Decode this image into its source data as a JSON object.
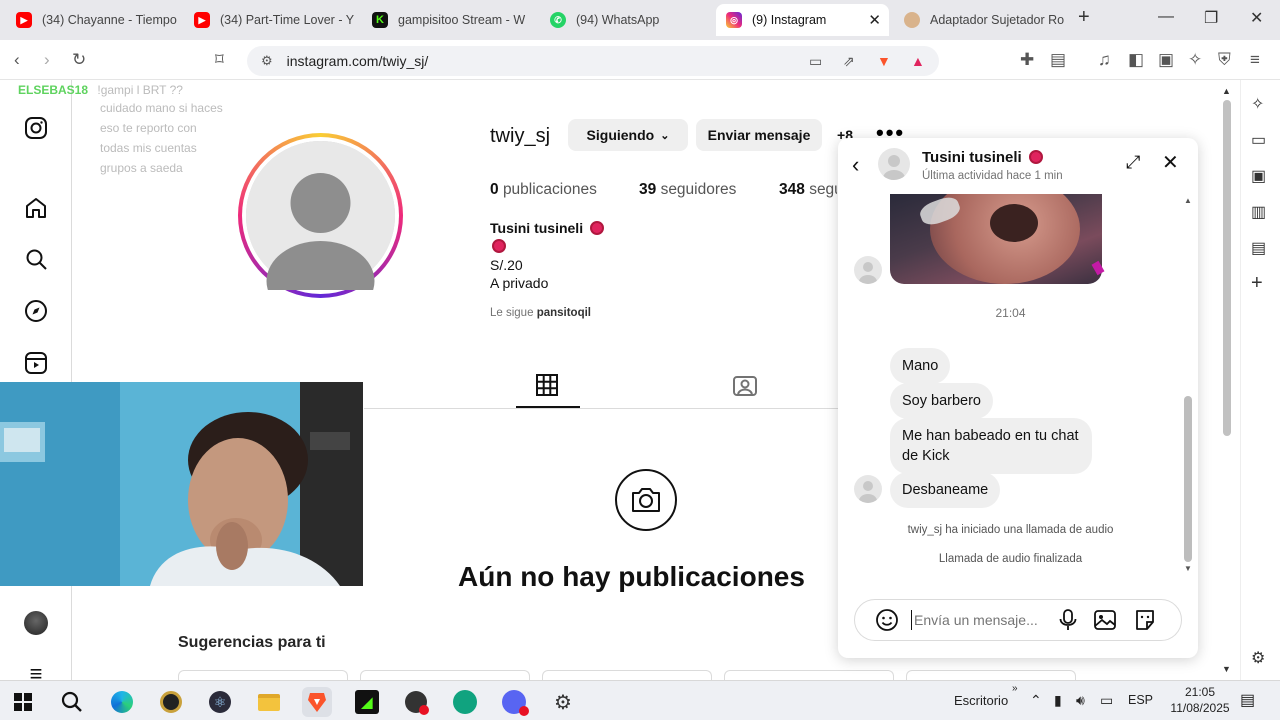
{
  "tabs": [
    {
      "title": "(34) Chayanne - Tiempo",
      "icon": "youtube-icon"
    },
    {
      "title": "(34) Part-Time Lover - Y",
      "icon": "youtube-icon"
    },
    {
      "title": "gampisitoo Stream - W",
      "icon": "kick-icon"
    },
    {
      "title": "(94) WhatsApp",
      "icon": "whatsapp-icon"
    },
    {
      "title": "(9) Instagram",
      "icon": "instagram-icon"
    },
    {
      "title": "Adaptador Sujetador Ro",
      "icon": "shop-icon"
    }
  ],
  "address": {
    "url": "instagram.com/twiy_sj/"
  },
  "overlay_chat": {
    "username": "ELSEBAS18",
    "message": "!gampi l BRT ??",
    "lines": [
      "cuidado mano si haces",
      "eso te reporto con",
      "todas mis cuentas",
      "grupos a saeda"
    ]
  },
  "profile": {
    "username": "twiy_sj",
    "following_label": "Siguiendo",
    "message_label": "Enviar mensaje",
    "more_label": "+8",
    "posts_count": "0",
    "posts_label": "publicaciones",
    "followers_count": "39",
    "followers_label": "seguidores",
    "following_count": "348",
    "following_label_short": "segu",
    "display_name": "Tusini tusineli",
    "bio_line1": "S/.20",
    "bio_line2": "A privado",
    "followed_by_prefix": "Le sigue",
    "followed_by_user": "pansitoqil",
    "no_posts": "Aún no hay publicaciones",
    "suggestions": "Sugerencias para ti"
  },
  "chat": {
    "name": "Tusini tusineli",
    "status": "Última actividad hace 1 min",
    "time": "21:04",
    "messages": [
      "Mano",
      "Soy barbero",
      "Me han babeado en tu chat de Kick",
      "Desbaneame"
    ],
    "event1": "twiy_sj ha iniciado una llamada de audio",
    "event2": "Llamada de audio finalizada",
    "input_placeholder": "Envía un mensaje..."
  },
  "taskbar": {
    "profile": "Escritorio",
    "lang": "ESP",
    "time": "21:05",
    "date": "11/08/2025"
  },
  "colors": {
    "ig_gradient_start": "#f9ce34",
    "ig_gradient_mid": "#ee2a7b",
    "ig_gradient_end": "#6228d7",
    "brave": "#fb542b",
    "kick": "#53fc18",
    "youtube": "#ff0000",
    "whatsapp": "#25d366"
  }
}
